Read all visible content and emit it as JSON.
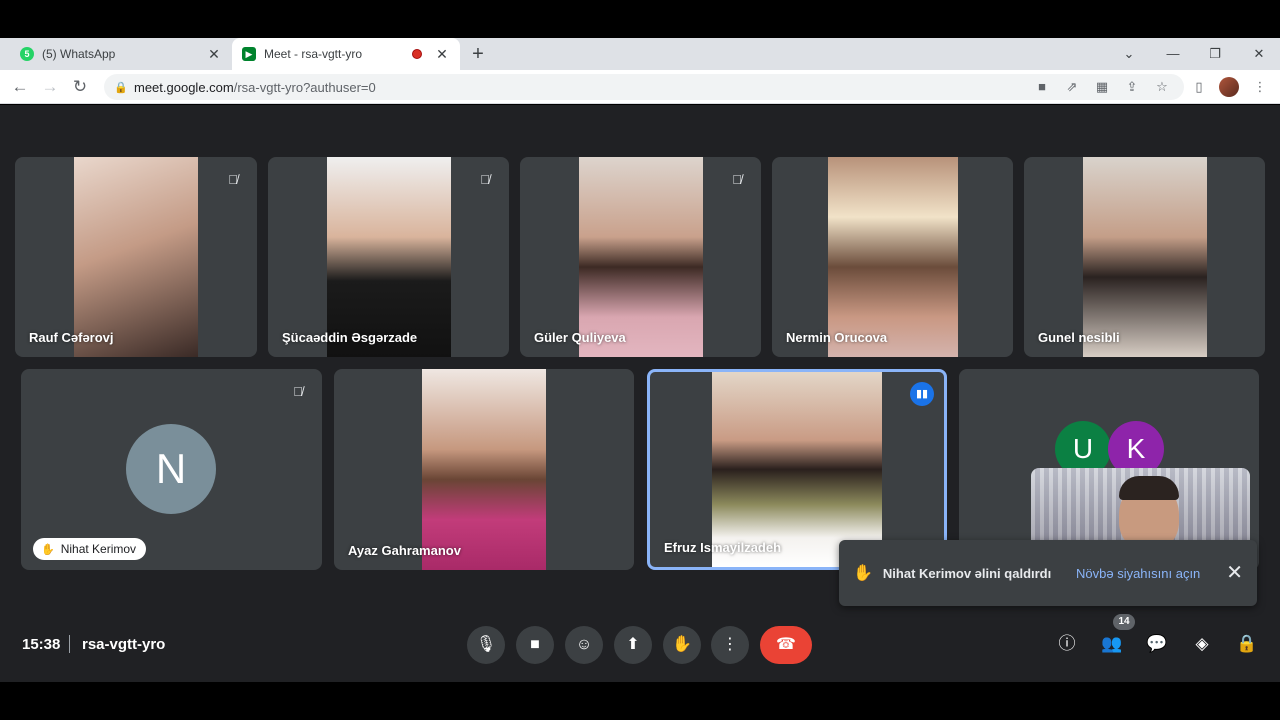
{
  "browser": {
    "tabs": [
      {
        "label": "(5) WhatsApp",
        "favicon_color": "#25d366",
        "favicon_glyph": "5"
      },
      {
        "label": "Meet - rsa-vgtt-yro",
        "favicon_color": "#00832d",
        "favicon_glyph": "▶"
      }
    ],
    "new_tab_glyph": "+",
    "close_glyph": "✕",
    "url_host": "meet.google.com",
    "url_path": "/rsa-vgtt-yro?authuser=0"
  },
  "participants_top": [
    {
      "name": "Rauf Cəfərovj",
      "muted": true
    },
    {
      "name": "Şücaəddin Əsgərzade",
      "muted": true
    },
    {
      "name": "Güler Quliyeva",
      "muted": true
    },
    {
      "name": "Nermin Orucova",
      "muted": false
    },
    {
      "name": "Gunel nesibli",
      "muted": false
    }
  ],
  "participants_bottom": [
    {
      "name": "Nihat Kerimov",
      "initial": "N",
      "muted": true,
      "hand_raised": true
    },
    {
      "name": "Ayaz Gahramanov",
      "muted": false
    },
    {
      "name": "Efruz Ismayilzadeh",
      "speaking": true
    }
  ],
  "others_tile": {
    "avatars": [
      {
        "initial": "U",
        "color": "#0b8043"
      },
      {
        "initial": "K",
        "color": "#8e24aa"
      }
    ]
  },
  "toast": {
    "message": "Nihat Kerimov əlini qaldırdı",
    "action": "Növbə siyahısını açın"
  },
  "bottom_bar": {
    "time": "15:38",
    "meeting_code": "rsa-vgtt-yro",
    "participant_count": "14"
  },
  "colors": {
    "meet_bg": "#202124",
    "tile_bg": "#3c4043",
    "end_call": "#ea4335",
    "accent_link": "#8ab4f8"
  }
}
